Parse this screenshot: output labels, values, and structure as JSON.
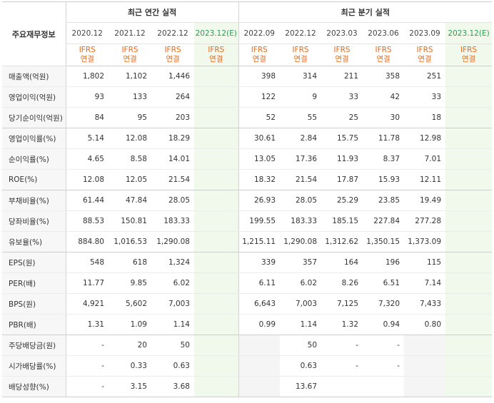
{
  "header": {
    "corner_label": "주요재무정보",
    "annual_title": "최근 연간 실적",
    "quarter_title": "최근 분기 실적",
    "annual_periods": [
      "2020.12",
      "2021.12",
      "2022.12",
      "2023.12(E)"
    ],
    "quarter_periods": [
      "2022.09",
      "2022.12",
      "2023.03",
      "2023.06",
      "2023.09",
      "2023.12(E)"
    ],
    "ifrs_top": "IFRS",
    "ifrs_bottom": "연결"
  },
  "rows": [
    {
      "label": "매출액(억원)",
      "values": [
        "1,802",
        "1,102",
        "1,446",
        "",
        "398",
        "314",
        "211",
        "358",
        "251",
        ""
      ]
    },
    {
      "label": "영업이익(억원)",
      "values": [
        "93",
        "133",
        "264",
        "",
        "122",
        "9",
        "33",
        "42",
        "33",
        ""
      ]
    },
    {
      "label": "당기순이익(억원)",
      "values": [
        "84",
        "95",
        "203",
        "",
        "52",
        "55",
        "25",
        "30",
        "18",
        ""
      ]
    },
    {
      "label": "영업이익률(%)",
      "values": [
        "5.14",
        "12.08",
        "18.29",
        "",
        "30.61",
        "2.84",
        "15.75",
        "11.78",
        "12.98",
        ""
      ]
    },
    {
      "label": "순이익률(%)",
      "values": [
        "4.65",
        "8.58",
        "14.01",
        "",
        "13.05",
        "17.36",
        "11.93",
        "8.37",
        "7.01",
        ""
      ]
    },
    {
      "label": "ROE(%)",
      "values": [
        "12.08",
        "12.05",
        "21.54",
        "",
        "18.32",
        "21.54",
        "17.87",
        "15.93",
        "12.11",
        ""
      ]
    },
    {
      "label": "부채비율(%)",
      "values": [
        "61.44",
        "47.84",
        "28.05",
        "",
        "26.93",
        "28.05",
        "25.29",
        "23.85",
        "19.49",
        ""
      ]
    },
    {
      "label": "당좌비율(%)",
      "values": [
        "88.53",
        "150.81",
        "183.33",
        "",
        "199.55",
        "183.33",
        "185.15",
        "227.84",
        "277.28",
        ""
      ]
    },
    {
      "label": "유보율(%)",
      "values": [
        "884.80",
        "1,016.53",
        "1,290.08",
        "",
        "1,215.11",
        "1,290.08",
        "1,312.62",
        "1,350.15",
        "1,373.09",
        ""
      ]
    },
    {
      "label": "EPS(원)",
      "values": [
        "548",
        "618",
        "1,324",
        "",
        "339",
        "357",
        "164",
        "196",
        "115",
        ""
      ]
    },
    {
      "label": "PER(배)",
      "values": [
        "11.77",
        "9.85",
        "6.02",
        "",
        "6.11",
        "6.02",
        "8.26",
        "6.51",
        "7.14",
        ""
      ]
    },
    {
      "label": "BPS(원)",
      "values": [
        "4,921",
        "5,602",
        "7,003",
        "",
        "6,643",
        "7,003",
        "7,125",
        "7,320",
        "7,433",
        ""
      ]
    },
    {
      "label": "PBR(배)",
      "values": [
        "1.31",
        "1.09",
        "1.14",
        "",
        "0.99",
        "1.14",
        "1.32",
        "0.94",
        "0.80",
        ""
      ]
    },
    {
      "label": "주당배당금(원)",
      "values": [
        "-",
        "20",
        "50",
        "",
        "",
        "50",
        "-",
        "-",
        "",
        ""
      ]
    },
    {
      "label": "시가배당률(%)",
      "values": [
        "-",
        "0.33",
        "0.63",
        "",
        "",
        "0.63",
        "-",
        "-",
        "",
        ""
      ]
    },
    {
      "label": "배당성향(%)",
      "values": [
        "-",
        "3.15",
        "3.68",
        "",
        "",
        "13.67",
        "",
        "",
        "",
        ""
      ]
    }
  ]
}
